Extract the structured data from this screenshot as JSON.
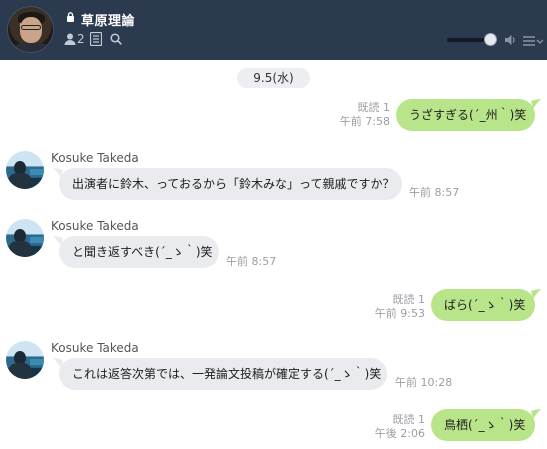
{
  "header": {
    "title": "草原理論",
    "member_count": "2",
    "colors": {
      "background": "#2b3a4f",
      "title": "#ffffff"
    },
    "icons": [
      "lock-icon",
      "member-icon",
      "notes-icon",
      "search-icon",
      "speaker-icon",
      "menu-icon"
    ],
    "volume_level": 0.78
  },
  "date_chip": "9.5(水)",
  "messages": [
    {
      "side": "mine",
      "text": "うざすぎる(´_州｀)笑",
      "read": "既読 1",
      "time": "午前 7:58"
    },
    {
      "side": "theirs",
      "sender": "Kosuke Takeda",
      "text": "出演者に鈴木、っておるから「鈴木みな」って親戚ですか？",
      "time": "午前 8:57"
    },
    {
      "side": "theirs",
      "sender": "Kosuke Takeda",
      "text": "と聞き返すべき(´_ゝ｀)笑",
      "time": "午前 8:57"
    },
    {
      "side": "mine",
      "text": "ばら(´_ゝ｀)笑",
      "read": "既読 1",
      "time": "午前 9:53"
    },
    {
      "side": "theirs",
      "sender": "Kosuke Takeda",
      "text": "これは返答次第では、一発論文投稿が確定する(´_ゝ｀)笑",
      "time": "午前 10:28"
    },
    {
      "side": "mine",
      "text": "鳥栖(´_ゝ｀)笑",
      "read": "既読 1",
      "time": "午後 2:06"
    }
  ],
  "colors": {
    "mine_bubble": "#b8e58a",
    "theirs_bubble": "#e9ebef",
    "meta_text": "#9a9ea4"
  }
}
